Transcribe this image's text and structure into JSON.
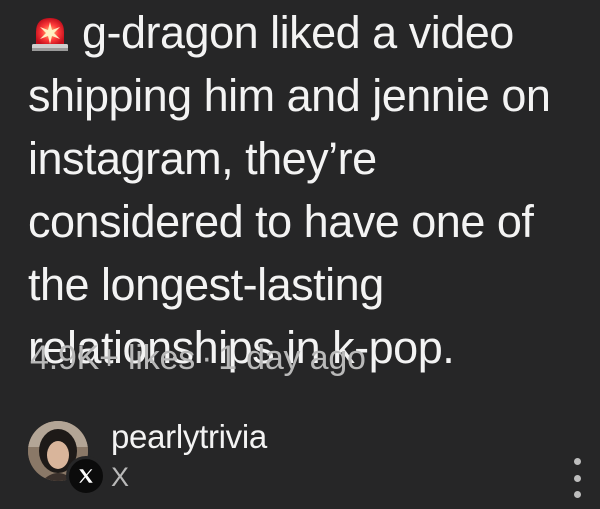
{
  "post": {
    "icon": "siren-emoji-icon",
    "headline": "g-dragon liked a video shipping him and jennie on instagram, they’re considered to have one of the longest-lasting relationships in k-pop.",
    "likes": "4.9K+ likes",
    "separator": "·",
    "time": "1 day ago"
  },
  "author": {
    "username": "pearlytrivia",
    "platform_label": "X",
    "badge_icon": "x-logo-icon"
  },
  "actions": {
    "more_icon": "vertical-ellipsis-icon"
  },
  "colors": {
    "background": "#262627",
    "primary_text": "#f3f3f3",
    "secondary_text": "#b9b9b9",
    "siren_red": "#e8192c"
  }
}
